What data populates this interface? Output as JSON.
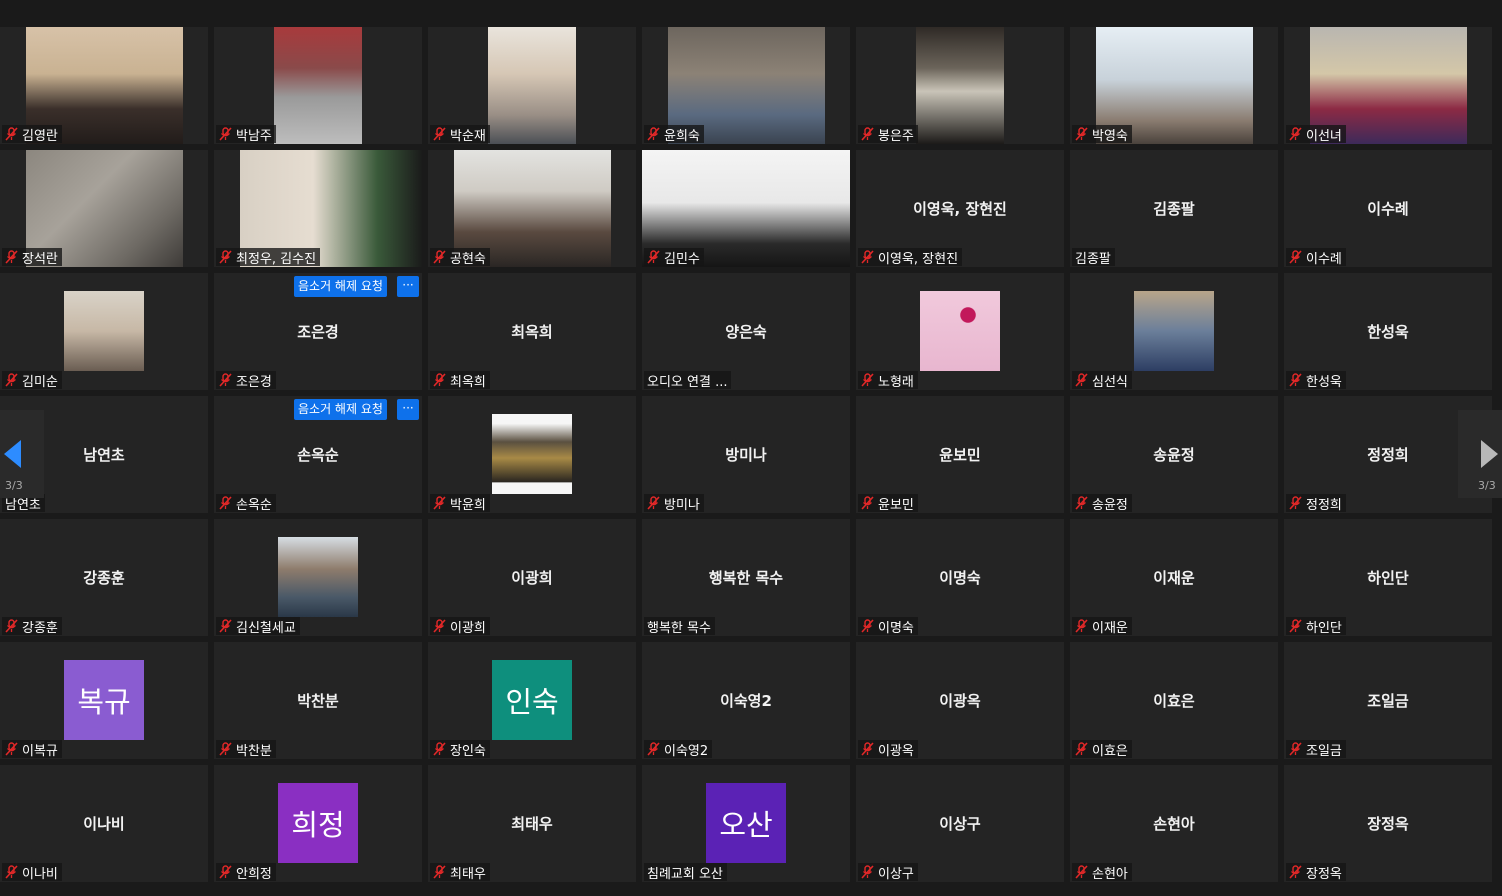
{
  "pagination": {
    "current_page": 3,
    "total_pages": 3,
    "left_indicator": "3/3",
    "right_indicator": "3/3"
  },
  "colors": {
    "accent": "#0e71eb",
    "muted_mic": "#e02828",
    "tile": "#242424",
    "background": "#1a1a1a"
  },
  "participants": [
    {
      "label": "김영란",
      "muted": true,
      "video": "video-a"
    },
    {
      "label": "박남주",
      "muted": true,
      "video": "video-b"
    },
    {
      "label": "박순재",
      "muted": true,
      "video": "video-c"
    },
    {
      "label": "윤희숙",
      "muted": true,
      "video": "video-d"
    },
    {
      "label": "봉은주",
      "muted": true,
      "video": "video-e"
    },
    {
      "label": "박영숙",
      "muted": true,
      "video": "video-f"
    },
    {
      "label": "이선녀",
      "muted": true,
      "video": "video-g"
    },
    {
      "label": "장석란",
      "muted": true,
      "video": "video-h"
    },
    {
      "label": "최정우, 김수진",
      "muted": true,
      "video": "video-i"
    },
    {
      "label": "공현숙",
      "muted": true,
      "video": "video-j"
    },
    {
      "label": "김민수",
      "muted": true,
      "video": "video-k"
    },
    {
      "label": "이영욱, 장현진",
      "muted": true,
      "display": "이영욱, 장현진"
    },
    {
      "label": "김종팔",
      "muted": false,
      "display": "김종팔"
    },
    {
      "label": "이수례",
      "muted": true,
      "display": "이수례"
    },
    {
      "label": "김미순",
      "muted": true,
      "photo": "portrait"
    },
    {
      "label": "조은경",
      "muted": true,
      "display": "조은경",
      "request": "음소거 해제 요청",
      "more": "···"
    },
    {
      "label": "최옥희",
      "muted": true,
      "display": "최옥희"
    },
    {
      "label": "오디오 연결 ...",
      "muted": false,
      "display": "양은숙"
    },
    {
      "label": "노형래",
      "muted": true,
      "photo": "flower"
    },
    {
      "label": "심선식",
      "muted": true,
      "photo": "speaker"
    },
    {
      "label": "한성욱",
      "muted": true,
      "display": "한성욱"
    },
    {
      "label": "남연초",
      "muted": false,
      "display": "남연초"
    },
    {
      "label": "손옥순",
      "muted": true,
      "display": "손옥순",
      "request": "음소거 해제 요청",
      "more": "···"
    },
    {
      "label": "박윤희",
      "muted": true,
      "photo": "crowd"
    },
    {
      "label": "방미나",
      "muted": true,
      "display": "방미나"
    },
    {
      "label": "윤보민",
      "muted": true,
      "display": "윤보민"
    },
    {
      "label": "송윤정",
      "muted": true,
      "display": "송윤정"
    },
    {
      "label": "정정희",
      "muted": true,
      "display": "정정희"
    },
    {
      "label": "강종훈",
      "muted": true,
      "display": "강종훈"
    },
    {
      "label": "김신철세교",
      "muted": true,
      "photo": "man"
    },
    {
      "label": "이광희",
      "muted": true,
      "display": "이광희"
    },
    {
      "label": "행복한 목수",
      "muted": false,
      "display": "행복한 목수"
    },
    {
      "label": "이명숙",
      "muted": true,
      "display": "이명숙"
    },
    {
      "label": "이재운",
      "muted": true,
      "display": "이재운"
    },
    {
      "label": "하인단",
      "muted": true,
      "display": "하인단"
    },
    {
      "label": "이복규",
      "muted": true,
      "avatar_text": "복규",
      "avatar_color": "#8a5cd1"
    },
    {
      "label": "박찬분",
      "muted": true,
      "display": "박찬분"
    },
    {
      "label": "장인숙",
      "muted": true,
      "avatar_text": "인숙",
      "avatar_color": "#0e8f7d"
    },
    {
      "label": "이숙영2",
      "muted": true,
      "display": "이숙영2"
    },
    {
      "label": "이광옥",
      "muted": true,
      "display": "이광옥"
    },
    {
      "label": "이효은",
      "muted": true,
      "display": "이효은"
    },
    {
      "label": "조일금",
      "muted": true,
      "display": "조일금"
    },
    {
      "label": "이나비",
      "muted": true,
      "display": "이나비"
    },
    {
      "label": "안희정",
      "muted": true,
      "avatar_text": "희정",
      "avatar_color": "#8a2fc2"
    },
    {
      "label": "최태우",
      "muted": true,
      "display": "최태우"
    },
    {
      "label": "침례교회 오산",
      "muted": false,
      "avatar_text": "오산",
      "avatar_color": "#5b22b5"
    },
    {
      "label": "이상구",
      "muted": true,
      "display": "이상구"
    },
    {
      "label": "손현아",
      "muted": true,
      "display": "손현아"
    },
    {
      "label": "장정옥",
      "muted": true,
      "display": "장정옥"
    }
  ]
}
